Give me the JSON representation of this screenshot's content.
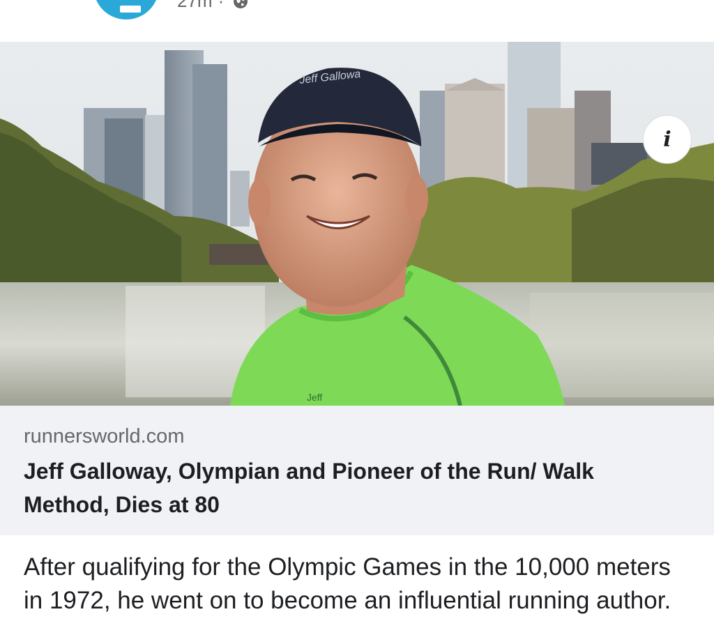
{
  "post": {
    "timestamp": "27m",
    "separator": "·",
    "privacy_icon": "globe-icon",
    "text": "After qualifying for the Olympic Games in the 10,000 meters in 1972, he went on to become an influential running author."
  },
  "link_preview": {
    "domain": "runnersworld.com",
    "title": "Jeff Galloway, Olympian and Pioneer of the Run/ Walk Method, Dies at 80",
    "info_label": "i",
    "image": {
      "description_icon": "photo",
      "cap_text": "Jeff Gallowa",
      "shirt_text": "Jeff"
    }
  },
  "colors": {
    "avatar_blue": "#2aa8d8",
    "caption_bg": "#f0f2f5",
    "secondary_text": "#65676b",
    "primary_text": "#1c1e21",
    "shirt_green": "#7ed957"
  }
}
